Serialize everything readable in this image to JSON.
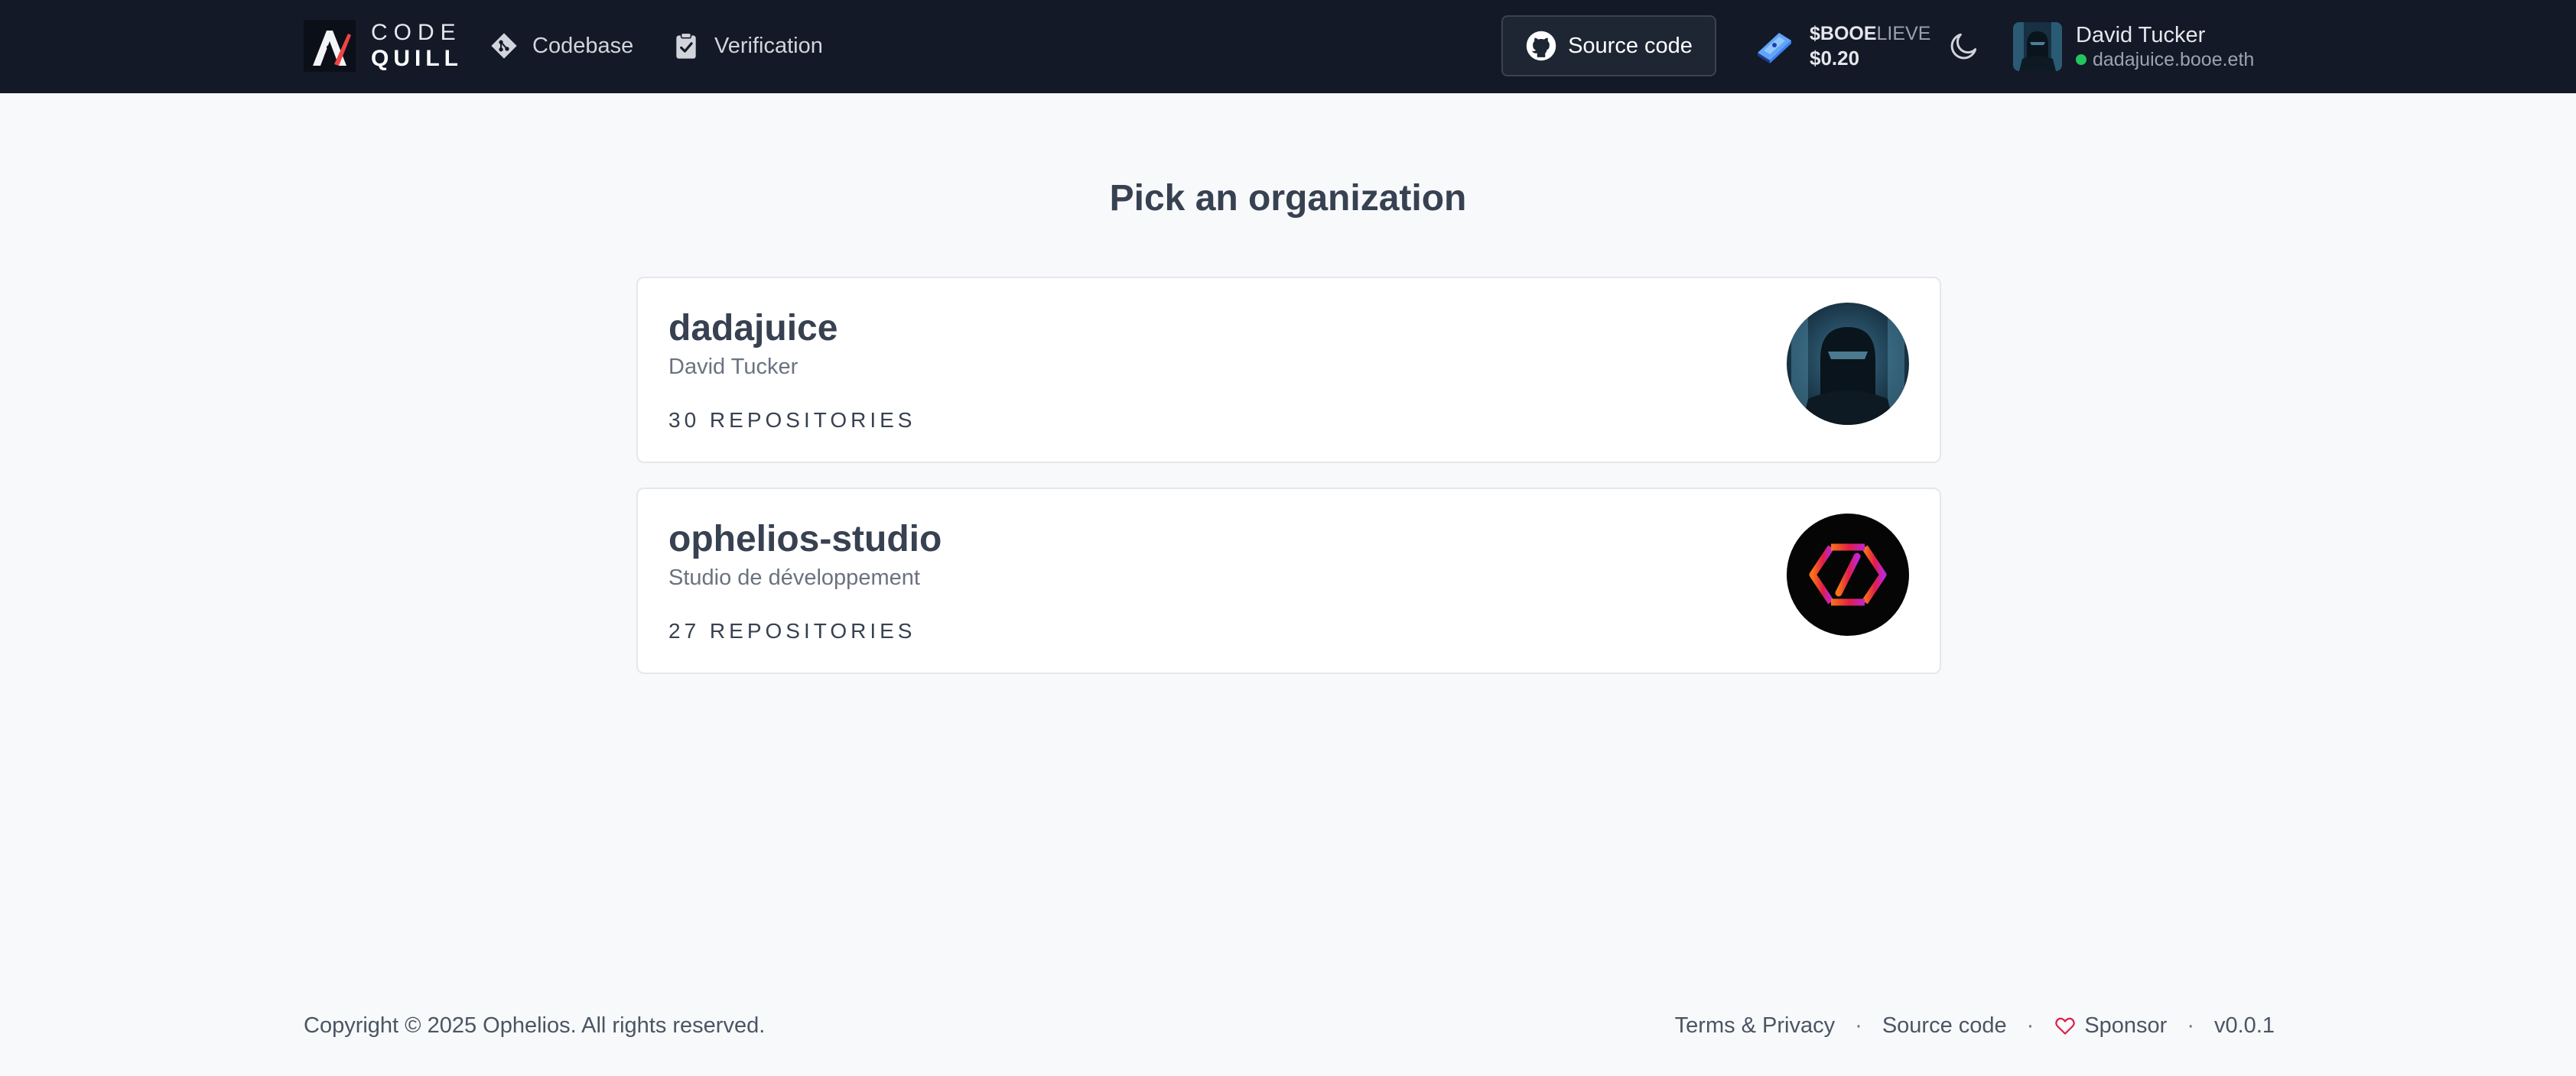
{
  "header": {
    "logo": {
      "line1": "CODE",
      "line2": "QUILL"
    },
    "nav": [
      {
        "label": "Codebase",
        "icon": "git-diamond-icon"
      },
      {
        "label": "Verification",
        "icon": "clipboard-check-icon"
      }
    ],
    "source_button": {
      "label": "Source code",
      "icon": "github-icon"
    },
    "token": {
      "symbol_bold": "$BOOE",
      "symbol_rest": "LIEVE",
      "price": "$0.20"
    },
    "theme_toggle": {
      "icon": "moon-icon"
    },
    "user": {
      "name": "David Tucker",
      "handle": "dadajuice.booe.eth",
      "status_color": "#22c55e"
    }
  },
  "main": {
    "title": "Pick an organization",
    "organizations": [
      {
        "name": "dadajuice",
        "description": "David Tucker",
        "repos": "30 REPOSITORIES"
      },
      {
        "name": "ophelios-studio",
        "description": "Studio de développement",
        "repos": "27 REPOSITORIES"
      }
    ]
  },
  "footer": {
    "copyright": "Copyright © 2025 Ophelios. All rights reserved.",
    "links": {
      "terms": "Terms & Privacy",
      "source": "Source code",
      "sponsor": "Sponsor",
      "version": "v0.0.1",
      "separator": "·"
    }
  },
  "colors": {
    "header_bg": "#131927",
    "page_bg": "#f8f9fb",
    "accent_pink": "#e11d48",
    "gradient_start": "#f97316",
    "gradient_end": "#c026d3"
  }
}
